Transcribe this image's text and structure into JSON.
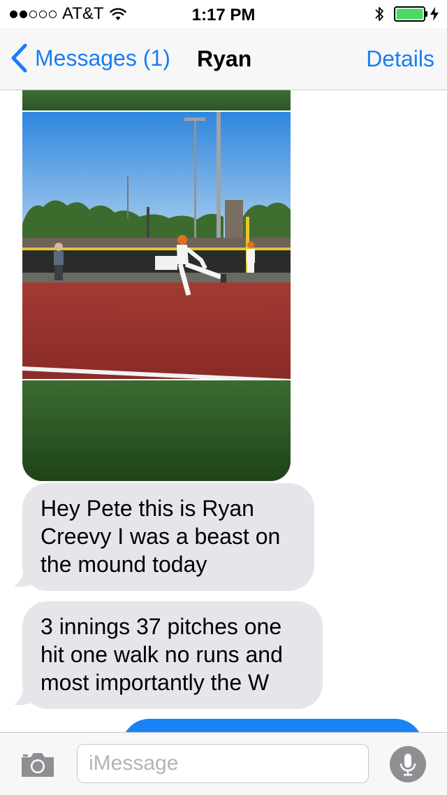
{
  "status_bar": {
    "carrier": "AT&T",
    "time": "1:17 PM",
    "signal_strength": 2,
    "signal_max": 5,
    "battery_level": 1.0,
    "battery_color": "#4cd964",
    "icons": [
      "signal-dots",
      "wifi-icon",
      "bluetooth-icon",
      "battery-icon",
      "charging-bolt-icon"
    ]
  },
  "nav": {
    "back_label": "Messages (1)",
    "title": "Ryan",
    "details_label": "Details",
    "accent_color": "#1a7cf5"
  },
  "conversation": {
    "messages": [
      {
        "from": "Ryan",
        "type": "photo"
      },
      {
        "from": "Ryan",
        "type": "text",
        "text": "Hey Pete this is Ryan Creevy I was a beast on the mound today"
      },
      {
        "from": "Ryan",
        "type": "text",
        "text": "3 innings 37 pitches one hit one walk no runs and most importantly the W"
      },
      {
        "from": "me",
        "type": "text",
        "text": ""
      }
    ],
    "incoming_bubble_color": "#e5e5ea",
    "outgoing_bubble_color": "#1a82f7"
  },
  "input_bar": {
    "placeholder": "iMessage",
    "value": "",
    "icons": [
      "camera-icon",
      "microphone-icon"
    ]
  }
}
